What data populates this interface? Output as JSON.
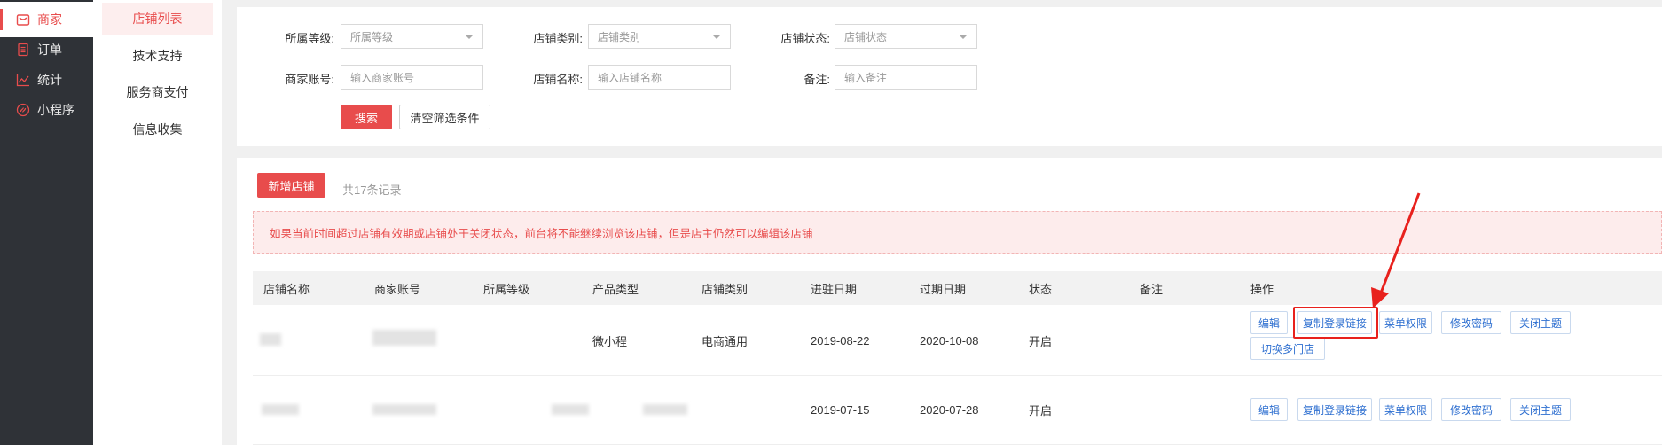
{
  "nav": {
    "items": [
      {
        "label": "商家",
        "icon": "shop-icon",
        "active": true
      },
      {
        "label": "订单",
        "icon": "order-icon",
        "active": false
      },
      {
        "label": "统计",
        "icon": "chart-icon",
        "active": false
      },
      {
        "label": "小程序",
        "icon": "miniprogram-icon",
        "active": false
      }
    ]
  },
  "subnav": {
    "items": [
      {
        "label": "店铺列表",
        "active": true
      },
      {
        "label": "技术支持",
        "active": false
      },
      {
        "label": "服务商支付",
        "active": false
      },
      {
        "label": "信息收集",
        "active": false
      }
    ]
  },
  "filter": {
    "level_label": "所属等级:",
    "level_placeholder": "所属等级",
    "category_label": "店铺类别:",
    "category_placeholder": "店铺类别",
    "status_label": "店铺状态:",
    "status_placeholder": "店铺状态",
    "account_label": "商家账号:",
    "account_placeholder": "输入商家账号",
    "name_label": "店铺名称:",
    "name_placeholder": "输入店铺名称",
    "remark_label": "备注:",
    "remark_placeholder": "输入备注",
    "search_button": "搜索",
    "clear_button": "清空筛选条件"
  },
  "list": {
    "add_button": "新增店铺",
    "count_text": "共17条记录",
    "notice": "如果当前时间超过店铺有效期或店铺处于关闭状态，前台将不能继续浏览该店铺，但是店主仍然可以编辑该店铺",
    "columns": [
      "店铺名称",
      "商家账号",
      "所属等级",
      "产品类型",
      "店铺类别",
      "进驻日期",
      "过期日期",
      "状态",
      "备注",
      "操作"
    ],
    "rows": [
      {
        "store_name": "",
        "account": "",
        "level": "",
        "product_type": "微小程",
        "category": "电商通用",
        "join_date": "2019-08-22",
        "expire_date": "2020-10-08",
        "status": "开启",
        "remark": "",
        "actions": [
          "编辑",
          "复制登录链接",
          "菜单权限",
          "修改密码",
          "关闭主题",
          "切换多门店"
        ]
      },
      {
        "store_name": "",
        "account": "",
        "level": "",
        "product_type": "",
        "category": "",
        "join_date": "2019-07-15",
        "expire_date": "2020-07-28",
        "status": "开启",
        "remark": "",
        "actions": [
          "编辑",
          "复制登录链接",
          "菜单权限",
          "修改密码",
          "关闭主题"
        ]
      }
    ]
  },
  "colors": {
    "accent": "#e84c4c",
    "nav_bg": "#2f3237",
    "link": "#2e6fd0",
    "annotation": "#e8211d"
  }
}
